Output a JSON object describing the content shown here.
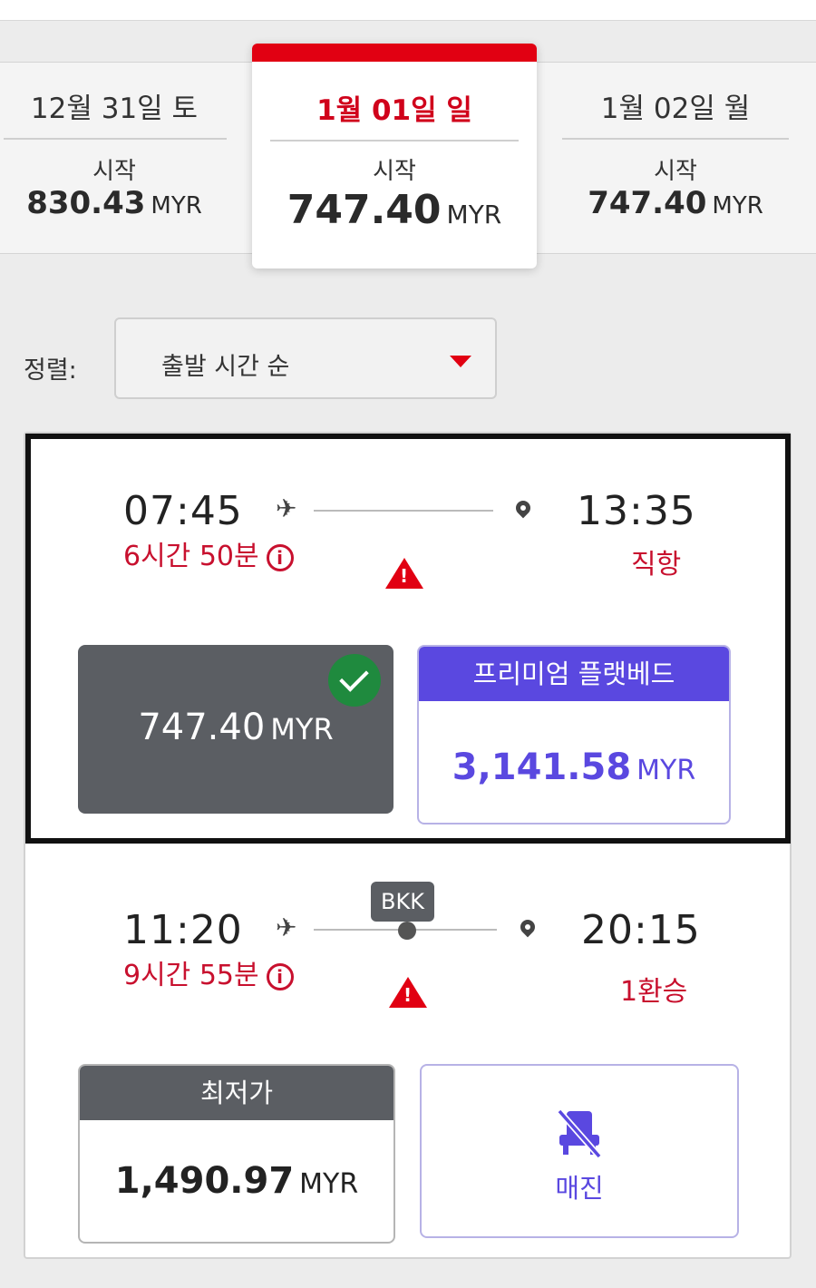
{
  "date_tabs": [
    {
      "label": "12월 31일 토",
      "from_label": "시작",
      "price": "830.43",
      "currency": "MYR"
    },
    {
      "label": "1월 01일 일",
      "from_label": "시작",
      "price": "747.40",
      "currency": "MYR"
    },
    {
      "label": "1월 02일 월",
      "from_label": "시작",
      "price": "747.40",
      "currency": "MYR"
    }
  ],
  "sort": {
    "label": "정렬:",
    "value": "출발 시간 순"
  },
  "flights": [
    {
      "depart": "07:45",
      "arrive": "13:35",
      "duration": "6시간 50분",
      "stops": "직항",
      "fares": {
        "selected": {
          "price": "747.40",
          "currency": "MYR"
        },
        "premium": {
          "header": "프리미엄 플랫베드",
          "price": "3,141.58",
          "currency": "MYR"
        }
      }
    },
    {
      "depart": "11:20",
      "arrive": "20:15",
      "duration": "9시간 55분",
      "stops": "1환승",
      "via": "BKK",
      "fares": {
        "lowest": {
          "header": "최저가",
          "price": "1,490.97",
          "currency": "MYR"
        },
        "soldout": {
          "label": "매진"
        }
      }
    }
  ],
  "colors": {
    "accent": "#e10012",
    "premium": "#5a48e0",
    "selected_fare": "#5b5e63",
    "check": "#1f8a3e",
    "warning": "#c8102e"
  }
}
